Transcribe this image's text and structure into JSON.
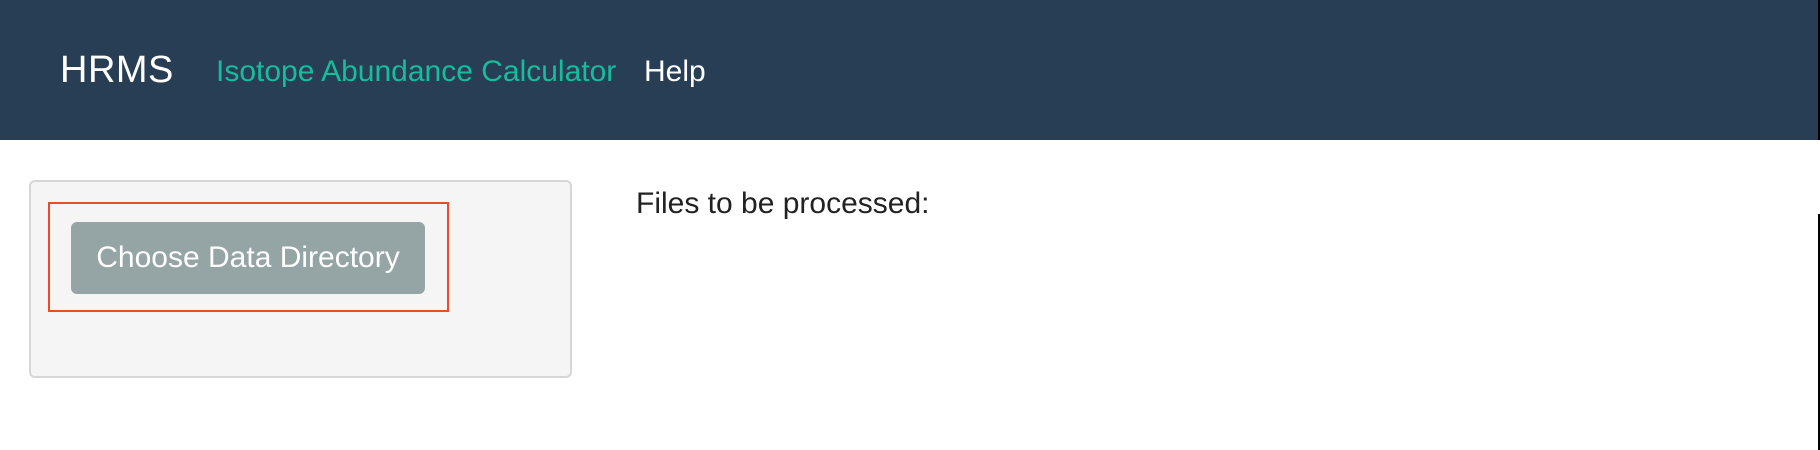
{
  "navbar": {
    "brand": "HRMS",
    "links": [
      {
        "label": "Isotope Abundance Calculator",
        "active": true
      },
      {
        "label": "Help",
        "active": false
      }
    ],
    "background_color": "#283e54",
    "active_link_color": "#18bc9c"
  },
  "sidebar": {
    "choose_directory_button": "Choose Data Directory"
  },
  "main": {
    "files_label": "Files to be processed:"
  }
}
